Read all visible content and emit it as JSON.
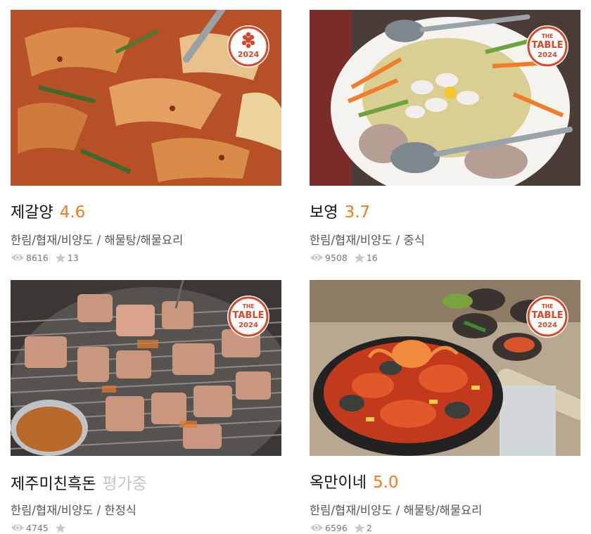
{
  "restaurants": [
    {
      "name": "제갈양",
      "rating": "4.6",
      "category": "한림/협재/비양도 / 해물탕/해물요리",
      "views": "8616",
      "favorites": "13",
      "badge": {
        "icon": "michelin-star-icon",
        "year": "2024"
      }
    },
    {
      "name": "보영",
      "rating": "3.7",
      "category": "한림/협재/비양도 / 중식",
      "views": "9508",
      "favorites": "16",
      "badge": {
        "line1": "THE",
        "line2": "TABLE",
        "year": "2024"
      }
    },
    {
      "name": "제주미친흑돈",
      "rating": "평가중",
      "category": "한림/협재/비양도 / 한정식",
      "views": "4745",
      "favorites": "",
      "badge": {
        "line1": "THE",
        "line2": "TABLE",
        "year": "2024"
      }
    },
    {
      "name": "옥만이네",
      "rating": "5.0",
      "category": "한림/협재/비양도 / 해물탕/해물요리",
      "views": "6596",
      "favorites": "2",
      "badge": {
        "line1": "THE",
        "line2": "TABLE",
        "year": "2024"
      }
    }
  ],
  "colors": {
    "rating": "#f07b1e",
    "rating_pending": "#c4c4c4",
    "badge": "#d5482a"
  }
}
